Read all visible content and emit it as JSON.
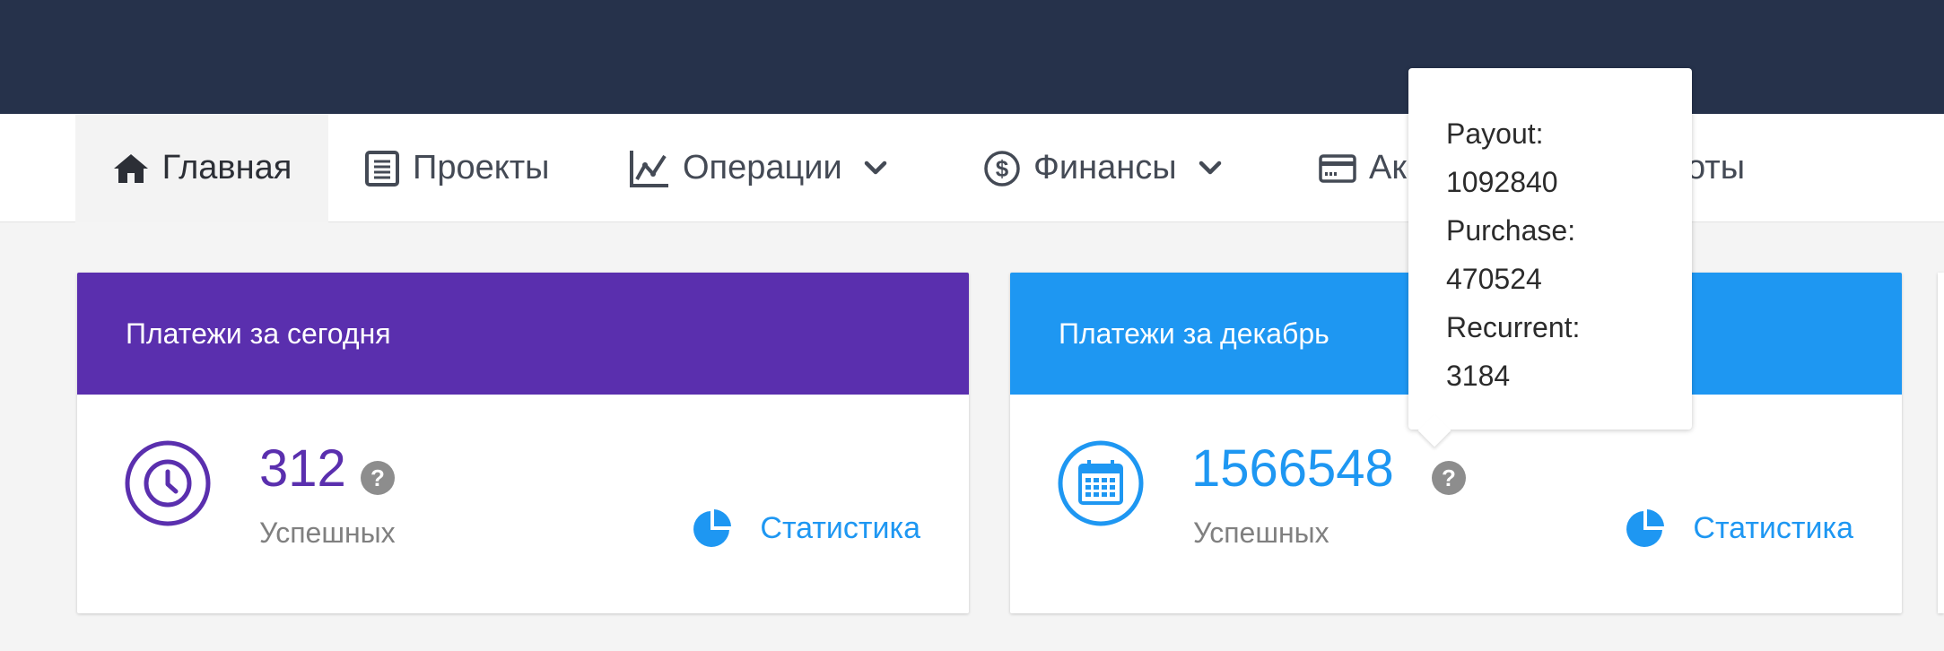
{
  "nav": {
    "items": [
      {
        "label": "Главная",
        "icon": "home-icon"
      },
      {
        "label": "Проекты",
        "icon": "document-icon"
      },
      {
        "label": "Операции",
        "icon": "chart-line-icon"
      },
      {
        "label": "Финансы",
        "icon": "dollar-circle-icon"
      },
      {
        "label": "Ак",
        "icon": "credit-card-icon"
      },
      {
        "label": "оты",
        "icon": ""
      }
    ]
  },
  "cards": [
    {
      "header": "Платежи за сегодня",
      "value": "312",
      "subtitle": "Успешных",
      "stats_label": "Статистика",
      "color": "#5a2fae",
      "icon": "clock-icon"
    },
    {
      "header": "Платежи за декабрь",
      "value": "1566548",
      "subtitle": "Успешных",
      "stats_label": "Статистика",
      "color": "#1e97f2",
      "icon": "calendar-icon"
    }
  ],
  "tooltip": {
    "lines": [
      "Payout:",
      "1092840",
      "Purchase:",
      "470524",
      "Recurrent:",
      "3184"
    ]
  },
  "colors": {
    "topbar": "#26324b",
    "accent_blue": "#1e97f2",
    "accent_purple": "#5a2fae"
  }
}
